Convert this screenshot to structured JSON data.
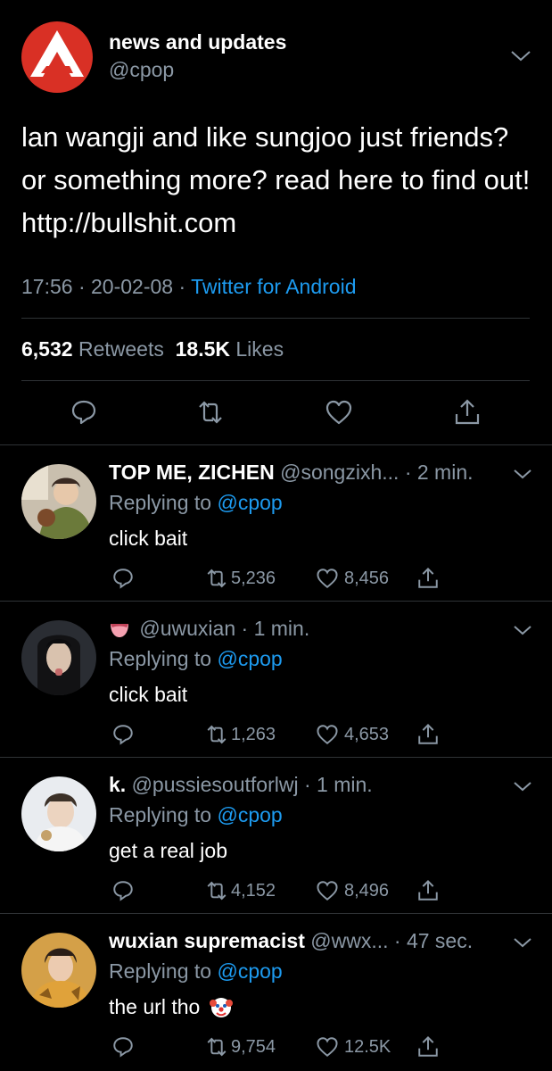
{
  "main_tweet": {
    "author_name": "news and updates",
    "author_handle": "@cpop",
    "text": "lan wangji and like sungjoo just friends? or something more? read here to find out! http://bullshit.com",
    "time": "17:56",
    "date": "20-02-08",
    "source": "Twitter for Android",
    "retweet_count": "6,532",
    "retweet_label": "Retweets",
    "like_count": "18.5K",
    "like_label": "Likes"
  },
  "replies": [
    {
      "name": "TOP ME, ZICHEN",
      "handle": "@songzixh...",
      "time": "2 min.",
      "replying_prefix": "Replying to",
      "replying_to": "@cpop",
      "text": "click bait",
      "retweets": "5,236",
      "likes": "8,456"
    },
    {
      "name": "",
      "handle": "@uwuxian",
      "time": "1 min.",
      "replying_prefix": "Replying to",
      "replying_to": "@cpop",
      "text": "click bait",
      "retweets": "1,263",
      "likes": "4,653"
    },
    {
      "name": "k.",
      "handle": "@pussiesoutforlwj",
      "time": "1 min.",
      "replying_prefix": "Replying to",
      "replying_to": "@cpop",
      "text": "get a real job",
      "retweets": "4,152",
      "likes": "8,496"
    },
    {
      "name": "wuxian supremacist",
      "handle": "@wwx...",
      "time": "47 sec.",
      "replying_prefix": "Replying to",
      "replying_to": "@cpop",
      "text": "the url tho",
      "retweets": "9,754",
      "likes": "12.5K"
    }
  ],
  "colors": {
    "background": "#000000",
    "link": "#1d9bf0",
    "muted": "#8b98a5",
    "logo": "#d93025"
  },
  "icons": [
    "reply-icon",
    "retweet-icon",
    "like-icon",
    "share-icon",
    "chevron-down-icon",
    "clown-emoji",
    "mouth-emoji"
  ]
}
